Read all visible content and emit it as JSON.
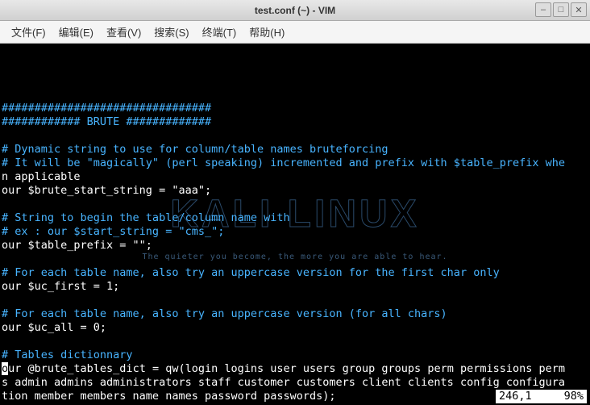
{
  "window": {
    "title": "test.conf (~) - VIM"
  },
  "menubar": {
    "file": "文件(F)",
    "edit": "编辑(E)",
    "view": "查看(V)",
    "search": "搜索(S)",
    "terminal": "终端(T)",
    "help": "帮助(H)"
  },
  "watermark": {
    "logo": "KALI LINUX",
    "tagline": "The quieter you become, the more you are able to hear."
  },
  "editor": {
    "lines": [
      "",
      "################################",
      "############ BRUTE #############",
      "",
      "# Dynamic string to use for column/table names bruteforcing",
      "# It will be \"magically\" (perl speaking) incremented and prefix with $table_prefix when applicable",
      "our $brute_start_string = \"aaa\";",
      "",
      "# String to begin the table/column name with",
      "# ex : our $start_string = \"cms_\";",
      "our $table_prefix = \"\";",
      "",
      "# For each table name, also try an uppercase version for the first char only",
      "our $uc_first = 1;",
      "",
      "# For each table name, also try an uppercase version (for all chars)",
      "our $uc_all = 0;",
      "",
      "# Tables dictionnary",
      "our @brute_tables_dict = qw(login logins user users group groups perm permissions perms admin admins administrators staff customer customers client clients config configuration member members name names password passwords);"
    ]
  },
  "status": {
    "position": "246,1",
    "percent": "98%"
  }
}
